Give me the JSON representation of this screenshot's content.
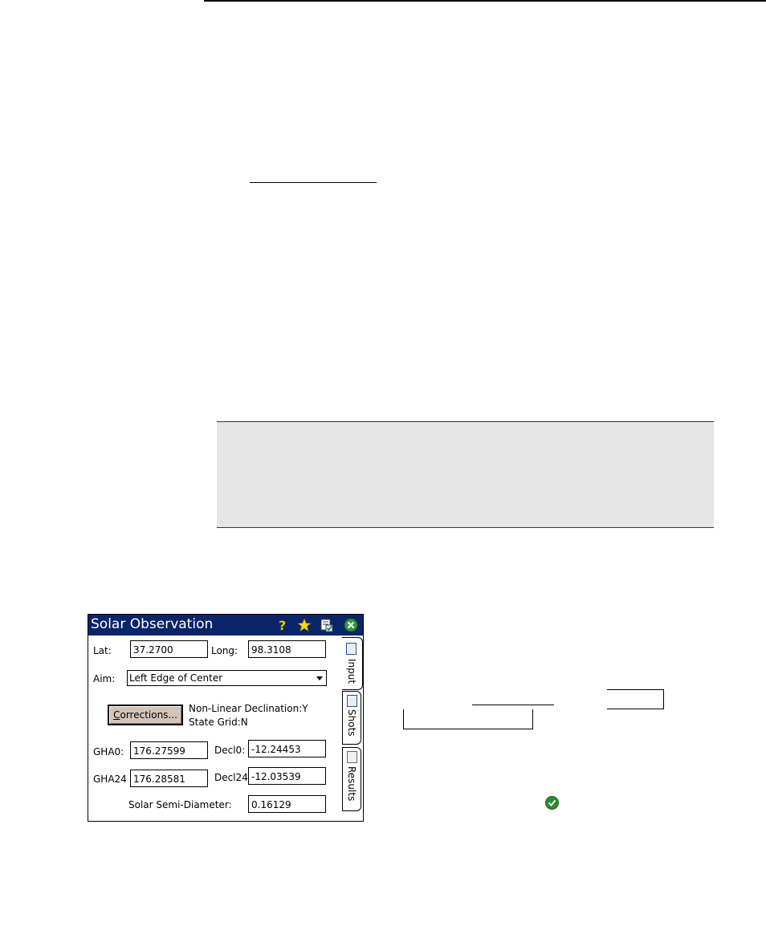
{
  "window": {
    "title": "Solar Observation",
    "titlebar_color": "#0a246a",
    "icons": [
      "help-icon",
      "favorites-star-icon",
      "settings-icon",
      "close-icon"
    ]
  },
  "form": {
    "lat_label": "Lat:",
    "lat_value": "37.2700",
    "long_label": "Long:",
    "long_value": "98.3108",
    "aim_label": "Aim:",
    "aim_value": "Left Edge of Center",
    "corrections_button": "Corrections...",
    "corrections_mnemonic": "C",
    "corrections_rest": "orrections...",
    "status_line1": "Non-Linear Declination:Y",
    "status_line2": "State Grid:N",
    "gha0_label": "GHA0:",
    "gha0_value": "176.27599",
    "decl0_label": "Decl0:",
    "decl0_value": "-12.24453",
    "gha24_label": "GHA24",
    "gha24_value": "176.28581",
    "decl24_label": "Decl24",
    "decl24_value": "-12.03539",
    "semi_diameter_label": "Solar Semi-Diameter:",
    "semi_diameter_value": "0.16129"
  },
  "tabs": [
    {
      "label": "Input"
    },
    {
      "label": "Shots"
    },
    {
      "label": "Results"
    }
  ]
}
